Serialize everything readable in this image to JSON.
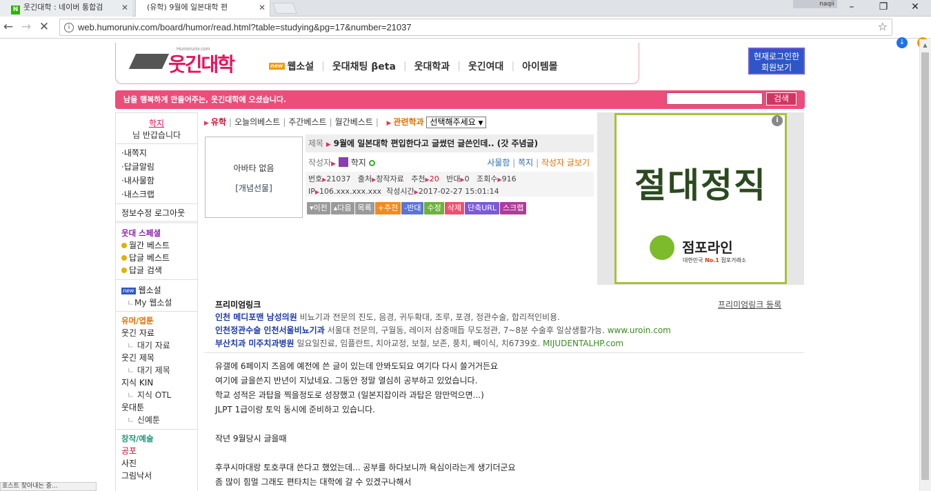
{
  "browser": {
    "tabs": [
      {
        "label": "웃긴대학 : 네이버 통합검",
        "favicon": "N"
      },
      {
        "label": "(유학) 9월에 일본대학 편"
      }
    ],
    "user": "naqii",
    "url": "web.humoruniv.com/board/humor/read.html?table=studying&pg=17&number=21037",
    "status": "호스트 찾아내는 중..."
  },
  "site": {
    "logo": "웃긴대학",
    "logo_small": "Humoruniv.com",
    "nav": [
      "웹소설",
      "웃대채팅 βeta",
      "웃대학과",
      "웃긴여대",
      "아이템몰"
    ],
    "nav_new": "new",
    "login_btn": [
      "현재로그인한",
      "회원보기"
    ],
    "banner": "남을 행복하게 만들어주는, 웃긴대학에 오셨습니다.",
    "search_btn": "검색"
  },
  "sidebar": {
    "user_name": "학지",
    "greeting": "님 반갑습니다",
    "my_items": [
      "·내쪽지",
      "·답글알림",
      "·내사물함",
      "·내스크랩"
    ],
    "edit_logout": "정보수정 로그아웃",
    "special_title": "웃대 스페셜",
    "special_items": [
      "월간 베스트",
      "답글 베스트",
      "답글 검색"
    ],
    "webnovel_badge": "new",
    "webnovel": "웹소설",
    "my_webnovel": "My 웹소설",
    "humor_title": "유머/엽툰",
    "humor_items": [
      {
        "label": "웃긴 자료",
        "sub": false
      },
      {
        "label": "대기 자료",
        "sub": true
      },
      {
        "label": "웃긴 제목",
        "sub": false
      },
      {
        "label": "대기 제목",
        "sub": true
      },
      {
        "label": "지식 KIN",
        "sub": false
      },
      {
        "label": "지식 OTL",
        "sub": true
      },
      {
        "label": "웃대툰",
        "sub": false
      },
      {
        "label": "신예툰",
        "sub": true
      }
    ],
    "art_title": "창작/예술",
    "art_items": [
      "공포",
      "사진",
      "그림낙서"
    ]
  },
  "breadcrumb": {
    "board": "유학",
    "links": [
      "오늘의베스트",
      "주간베스트",
      "월간베스트"
    ],
    "related": "관련학과",
    "select": "선택해주세요"
  },
  "post": {
    "avatar_none": "아바타 없음",
    "gift": "[개념선물]",
    "title_label": "제목",
    "title": "9월에 일본대학 편입한다고 글썼던 글쓴인데.. (갓 주념글)",
    "author_label": "작성자",
    "author": "학지",
    "links": [
      "사물함",
      "쪽지",
      "작성자 글보기"
    ],
    "meta_line1": {
      "no_label": "번호",
      "no": "21037",
      "src_label": "출처",
      "src": "창작자료",
      "rec_label": "추천",
      "rec": "20",
      "opp_label": "반대",
      "opp": "0",
      "views_label": "조회수",
      "views": "916"
    },
    "meta_line2": {
      "ip_label": "IP",
      "ip": "106.xxx.xxx.xxx",
      "time_label": "작성시간",
      "time": "2017-02-27 15:01:14"
    },
    "buttons": [
      {
        "label": "▾이전",
        "color": "#9a9a9a"
      },
      {
        "label": "▴다음",
        "color": "#9a9a9a"
      },
      {
        "label": "목록",
        "color": "#9a9a9a"
      },
      {
        "label": "+추천",
        "color": "#f08c1e"
      },
      {
        "label": "-반대",
        "color": "#5b74d6"
      },
      {
        "label": "수정",
        "color": "#6bb33a"
      },
      {
        "label": "삭제",
        "color": "#f0506e"
      },
      {
        "label": "단축URL",
        "color": "#7a5ad6"
      },
      {
        "label": "스크랩",
        "color": "#b03a9a"
      }
    ]
  },
  "ad": {
    "headline": "절대정직",
    "brand": "점포라인",
    "tagline_pre": "대한민국 ",
    "tagline_no1": "No.1",
    "tagline_post": " 점포거래소",
    "info": "i"
  },
  "premium": {
    "title": "프리미엄링크",
    "register": "프리미엄링크 등록",
    "rows": [
      {
        "title": "인천 메디포맨 남성의원",
        "desc": " 비뇨기과 전문의 진도, 음경, 귀두확대, 조루, 포경, 정관수술, 합리적인비용.",
        "url": ""
      },
      {
        "title": "인천정관수술 인천서울비뇨기과",
        "desc": " 서울대 전문의, 구월동, 레이저 삼중매듭 무도정관, 7~8분 수술후 일상생활가능.",
        "url": " www.uroin.com"
      },
      {
        "title": "부산치과 미주치과병원",
        "desc": " 일요일진료, 임플란트, 치아교정, 보철, 보존, 풍치, 빼이식, 치6739호.",
        "url": " MIJUDENTALHP.com"
      }
    ]
  },
  "body": [
    "유갤에 6페이지 즈음에 예전에 쓴 글이 있는데 안봐도되요 여기다 다시 쓸거거든요",
    "여기에 글을쓴지 반년이 지났네요. 그동안 정말 열심히 공부하고 있었습니다.",
    "학교 성적은 과탑을 찍을정도로 성장했고   (일본지잡이라 과탑은 맘만먹으면...)",
    "JLPT 1급이랑 토익 동시에 준비하고 있습니다.",
    "",
    "작년 9월당시 글을때",
    "",
    "후쿠시마대랑 토호쿠대 쓴다고 했었는데... 공부를 하다보니까 욕심이라는게 생기더군요",
    "좀 많이 힘멀 그래도 편타치는 대학에 갈 수 있겠구나해서"
  ]
}
